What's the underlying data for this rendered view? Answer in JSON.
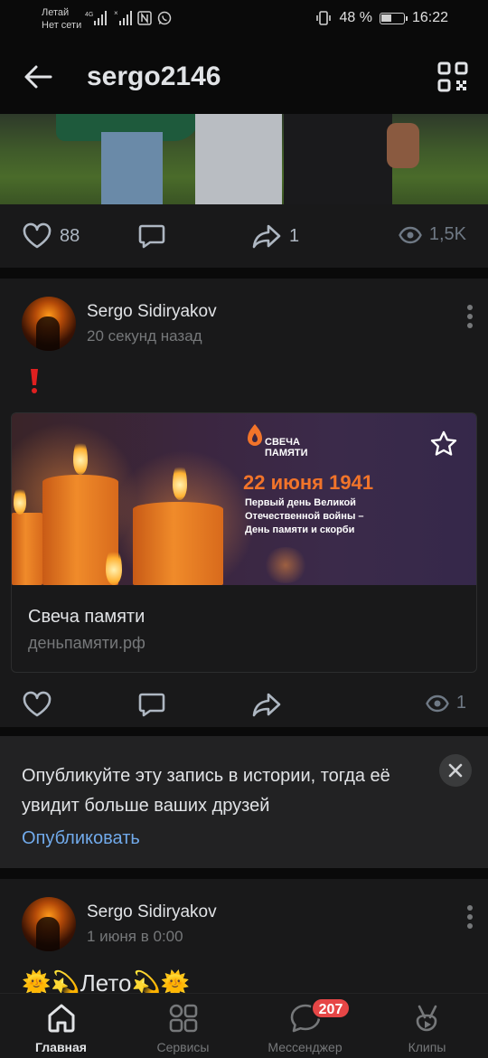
{
  "status_bar": {
    "carrier_line1": "Летай",
    "carrier_line2": "Нет сети",
    "network_tag": "4G",
    "battery_percent": "48 %",
    "battery_level": 0.48,
    "time": "16:22"
  },
  "header": {
    "title": "sergo2146"
  },
  "post1": {
    "likes": "88",
    "shares": "1",
    "views": "1,5K"
  },
  "post2": {
    "author": "Sergo Sidiryakov",
    "time": "20 секунд назад",
    "text": "❗",
    "link": {
      "banner_logo_text_line1": "СВЕЧА",
      "banner_logo_text_line2": "ПАМЯТИ",
      "banner_date": "22 июня 1941",
      "banner_sub_line1": "Первый день Великой",
      "banner_sub_line2": "Отечественной войны –",
      "banner_sub_line3": "День памяти и скорби",
      "title": "Свеча памяти",
      "url": "деньпамяти.рф"
    },
    "views": "1"
  },
  "promo": {
    "text": "Опубликуйте эту запись в истории, тогда её увидит больше ваших друзей",
    "action": "Опубликовать"
  },
  "post3": {
    "author": "Sergo Sidiryakov",
    "time": "1 июня в 0:00",
    "text": "🌞💫Лето💫🌞"
  },
  "tabbar": {
    "tabs": [
      {
        "label": "Главная",
        "icon": "home-icon",
        "active": true
      },
      {
        "label": "Сервисы",
        "icon": "services-icon"
      },
      {
        "label": "Мессенджер",
        "icon": "messenger-icon",
        "badge": "207"
      },
      {
        "label": "Клипы",
        "icon": "clips-icon"
      }
    ]
  },
  "colors": {
    "background": "#0a0a0a",
    "card": "#19191a",
    "accent_link": "#71aaeb",
    "badge": "#e64646",
    "exclaim": "#e02020"
  }
}
